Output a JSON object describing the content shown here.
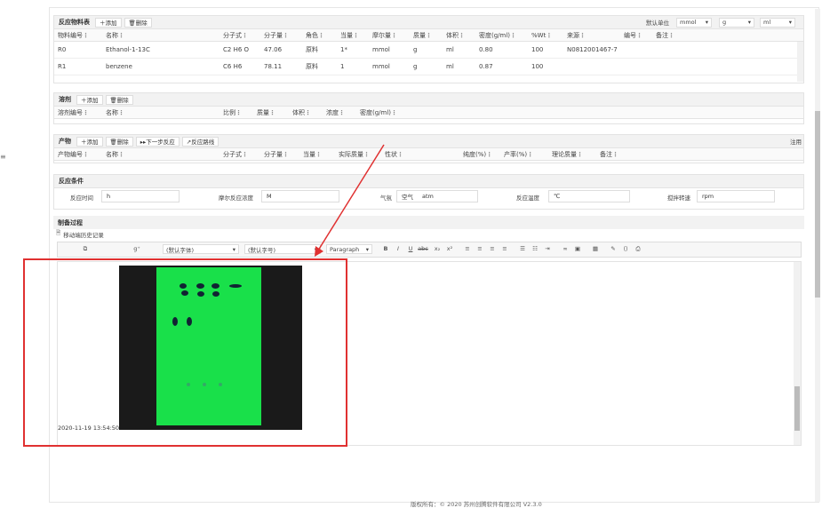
{
  "reactants": {
    "title": "反应物料表",
    "add": "＋添加",
    "del": "🗑删除",
    "unit_label": "默认单位",
    "units": [
      "mmol",
      "g",
      "ml"
    ],
    "columns": [
      "物料编号",
      "名称",
      "分子式",
      "分子量",
      "角色",
      "当量",
      "摩尔量",
      "质量",
      "体积",
      "密度(g/ml)",
      "%Wt",
      "来源",
      "编号",
      "备注"
    ],
    "rows": [
      [
        "R0",
        "Ethanol-1-13C",
        "C2 H6 O",
        "47.06",
        "原料",
        "1*",
        "mmol",
        "g",
        "ml",
        "0.80",
        "100",
        "N0812001467-7"
      ],
      [
        "R1",
        "benzene",
        "C6 H6",
        "78.11",
        "原料",
        "1",
        "mmol",
        "g",
        "ml",
        "0.87",
        "100",
        ""
      ]
    ]
  },
  "solvent": {
    "title": "溶剂",
    "add": "＋添加",
    "del": "🗑删除",
    "columns": [
      "溶剂编号",
      "名称",
      "比例",
      "质量",
      "体积",
      "浓度",
      "密度(g/ml)"
    ]
  },
  "product": {
    "title": "产物",
    "add": "＋添加",
    "del": "🗑删除",
    "next": "▸▸下一步反应",
    "route": "↗反应路线",
    "note": "注用",
    "columns": [
      "产物编号",
      "名称",
      "分子式",
      "分子量",
      "当量",
      "实际质量",
      "性状",
      "纯度(%)",
      "产率(%)",
      "理论质量",
      "备注"
    ]
  },
  "conditions": {
    "title": "反应条件",
    "fields": [
      {
        "label": "反应时间",
        "value": "h"
      },
      {
        "label": "摩尔反应浓度",
        "value": "M"
      },
      {
        "label": "气氛",
        "value": "空气",
        "unit": "atm"
      },
      {
        "label": "反应温度",
        "value": "℃"
      },
      {
        "label": "搅拌转速",
        "value": "rpm"
      }
    ]
  },
  "process": {
    "title": "制备过程",
    "history": "移动端历史记录",
    "font_default": "(默认字体)",
    "size_default": "(默认字号)",
    "paragraph": "Paragraph",
    "timestamp": "2020-11-19 13:54:50"
  },
  "footer": "版权所有：© 2020 苏州创腾软件有限公司  V2.3.0",
  "colors": {
    "highlight": "#e03131",
    "tlc_green": "#19e04a"
  }
}
